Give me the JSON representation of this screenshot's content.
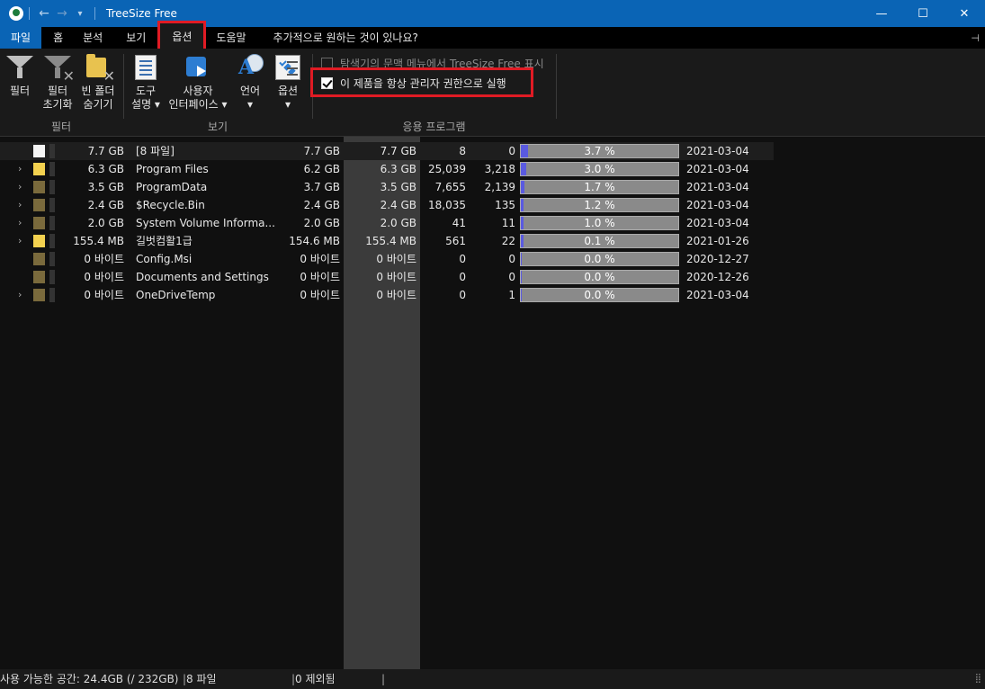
{
  "titlebar": {
    "title": "TreeSize Free",
    "minimize": "—",
    "maximize": "☐",
    "close": "✕"
  },
  "menu": {
    "tabs": [
      {
        "label": "파일"
      },
      {
        "label": "홈"
      },
      {
        "label": "분석"
      },
      {
        "label": "보기"
      },
      {
        "label": "옵션"
      },
      {
        "label": "도움말"
      },
      {
        "label": "추가적으로 원하는 것이 있나요?"
      }
    ],
    "active_tab": "옵션"
  },
  "ribbon": {
    "filter_group": {
      "label": "필터",
      "buttons": [
        {
          "label1": "필터",
          "label2": ""
        },
        {
          "label1": "필터",
          "label2": "초기화"
        },
        {
          "label1": "빈 폴더",
          "label2": "숨기기"
        }
      ]
    },
    "view_group": {
      "label": "보기",
      "buttons": [
        {
          "label1": "도구",
          "label2": "설명 ▾"
        },
        {
          "label1": "사용자",
          "label2": "인터페이스 ▾"
        },
        {
          "label1": "언어",
          "label2": "▾"
        },
        {
          "label1": "옵션",
          "label2": "▾"
        }
      ]
    },
    "app_group": {
      "label": "응용 프로그램",
      "checkbox_explorer": {
        "label": "탐색기의 문맥 메뉴에서 TreeSize Free 표시",
        "checked": false
      },
      "checkbox_admin": {
        "label": "이 제품을 항상 관리자 권한으로 실행",
        "checked": true
      }
    }
  },
  "rows": [
    {
      "size": "7.7 GB",
      "name": "[8 파일]",
      "alloc": "7.7 GB",
      "size2": "7.7 GB",
      "files": "8",
      "folders": "0",
      "percent": "3.7 %",
      "pct": 3.7,
      "date": "2021-03-04",
      "icon": "file",
      "expand": ""
    },
    {
      "size": "6.3 GB",
      "name": "Program Files",
      "alloc": "6.2 GB",
      "size2": "6.3 GB",
      "files": "25,039",
      "folders": "3,218",
      "percent": "3.0 %",
      "pct": 3.0,
      "date": "2021-03-04",
      "icon": "yellow",
      "expand": "›"
    },
    {
      "size": "3.5 GB",
      "name": "ProgramData",
      "alloc": "3.7 GB",
      "size2": "3.5 GB",
      "files": "7,655",
      "folders": "2,139",
      "percent": "1.7 %",
      "pct": 1.7,
      "date": "2021-03-04",
      "icon": "dark",
      "expand": "›"
    },
    {
      "size": "2.4 GB",
      "name": "$Recycle.Bin",
      "alloc": "2.4 GB",
      "size2": "2.4 GB",
      "files": "18,035",
      "folders": "135",
      "percent": "1.2 %",
      "pct": 1.2,
      "date": "2021-03-04",
      "icon": "dark",
      "expand": "›"
    },
    {
      "size": "2.0 GB",
      "name": "System Volume Informa...",
      "alloc": "2.0 GB",
      "size2": "2.0 GB",
      "files": "41",
      "folders": "11",
      "percent": "1.0 %",
      "pct": 1.0,
      "date": "2021-03-04",
      "icon": "dark",
      "expand": "›"
    },
    {
      "size": "155.4 MB",
      "name": "길벗컴활1급",
      "alloc": "154.6 MB",
      "size2": "155.4 MB",
      "files": "561",
      "folders": "22",
      "percent": "0.1 %",
      "pct": 0.1,
      "date": "2021-01-26",
      "icon": "yellow",
      "expand": "›"
    },
    {
      "size": "0 바이트",
      "name": "Config.Msi",
      "alloc": "0 바이트",
      "size2": "0 바이트",
      "files": "0",
      "folders": "0",
      "percent": "0.0 %",
      "pct": 0,
      "date": "2020-12-27",
      "icon": "dark",
      "expand": ""
    },
    {
      "size": "0 바이트",
      "name": "Documents and Settings",
      "alloc": "0 바이트",
      "size2": "0 바이트",
      "files": "0",
      "folders": "0",
      "percent": "0.0 %",
      "pct": 0,
      "date": "2020-12-26",
      "icon": "dark",
      "expand": ""
    },
    {
      "size": "0 바이트",
      "name": "OneDriveTemp",
      "alloc": "0 바이트",
      "size2": "0 바이트",
      "files": "0",
      "folders": "1",
      "percent": "0.0 %",
      "pct": 0,
      "date": "2021-03-04",
      "icon": "dark",
      "expand": "›"
    }
  ],
  "status": {
    "free_space": "사용 가능한 공간: 24.4GB  (/ 232GB)",
    "files": "8 파일",
    "excluded": "0 제외됨"
  },
  "colors": {
    "accent": "#0a64b5",
    "highlight": "#e01b24",
    "bar_fill": "#5a5ae0"
  }
}
